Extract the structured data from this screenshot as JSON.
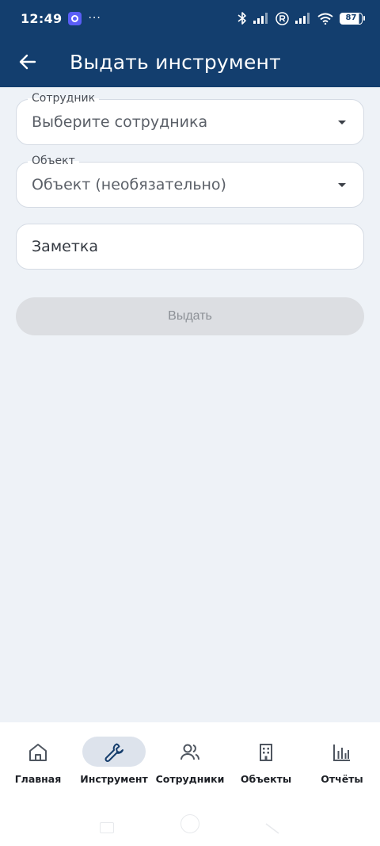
{
  "status_bar": {
    "time": "12:49",
    "more": "···",
    "battery": "87"
  },
  "app_bar": {
    "title": "Выдать инструмент"
  },
  "form": {
    "employee": {
      "label": "Сотрудник",
      "placeholder": "Выберите сотрудника"
    },
    "object": {
      "label": "Объект",
      "placeholder": "Объект (необязательно)"
    },
    "note": {
      "placeholder": "Заметка"
    },
    "submit_label": "Выдать"
  },
  "bottom_nav": {
    "items": [
      {
        "label": "Главная",
        "icon": "home-icon",
        "active": false
      },
      {
        "label": "Инструмент",
        "icon": "wrench-icon",
        "active": true
      },
      {
        "label": "Сотрудники",
        "icon": "people-icon",
        "active": false
      },
      {
        "label": "Объекты",
        "icon": "building-icon",
        "active": false
      },
      {
        "label": "Отчёты",
        "icon": "bar-chart-icon",
        "active": false
      }
    ]
  },
  "colors": {
    "header": "#133e6e",
    "background": "#eef2f7",
    "active_nav_pill": "#dde3ec",
    "disabled_button": "#dcdee2"
  }
}
